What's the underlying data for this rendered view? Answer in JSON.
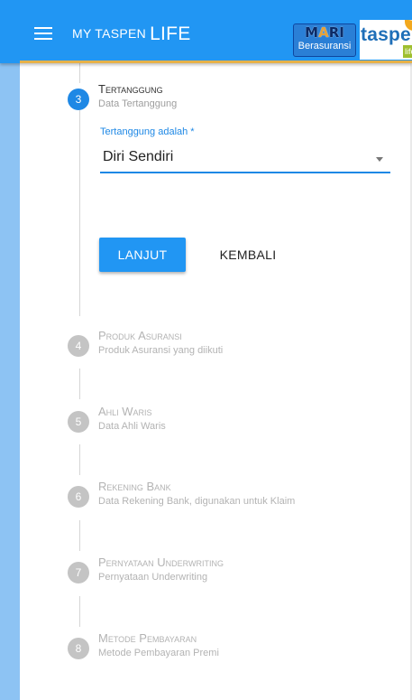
{
  "header": {
    "brand_prefix": "MY TASPEN",
    "brand_suffix": "LIFE",
    "menu_icon": "hamburger-menu-icon",
    "mari_logo_top": "MARI",
    "mari_logo_bottom": "Berasuransi",
    "taspen_logo_text": "taspen",
    "taspen_logo_tag": "life",
    "colors": {
      "appbar": "#2196f3",
      "accent_line": "#e6b14a"
    }
  },
  "form": {
    "field_label": "Tertanggung adalah *",
    "field_value": "Diri Sendiri",
    "next_button": "LANJUT",
    "back_button": "KEMBALI"
  },
  "steps": [
    {
      "number": "3",
      "title": "Tertanggung",
      "subtitle": "Data Tertanggung",
      "state": "active"
    },
    {
      "number": "4",
      "title": "Produk Asuransi",
      "subtitle": "Produk Asuransi yang diikuti",
      "state": "inactive"
    },
    {
      "number": "5",
      "title": "Ahli Waris",
      "subtitle": "Data Ahli Waris",
      "state": "inactive"
    },
    {
      "number": "6",
      "title": "Rekening Bank",
      "subtitle": "Data Rekening Bank, digunakan untuk Klaim",
      "state": "inactive"
    },
    {
      "number": "7",
      "title": "Pernyataan Underwriting",
      "subtitle": "Pernyataan Underwriting",
      "state": "inactive"
    },
    {
      "number": "8",
      "title": "Metode Pembayaran",
      "subtitle": "Metode Pembayaran Premi",
      "state": "inactive"
    }
  ],
  "colors": {
    "active_step": "#1e88e5",
    "inactive_step": "#c4c4c4",
    "left_strip": "#8dc3f3"
  }
}
